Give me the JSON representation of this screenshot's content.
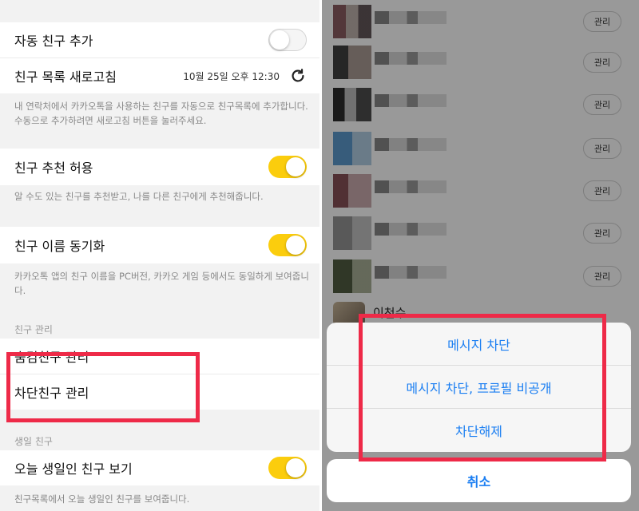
{
  "left": {
    "auto_add": {
      "label": "자동 친구 추가",
      "toggle": "off"
    },
    "refresh": {
      "label": "친구 목록 새로고침",
      "timestamp": "10월 25일 오후 12:30",
      "icon": "refresh-icon"
    },
    "auto_add_desc": "내 연락처에서 카카오톡을 사용하는 친구를 자동으로 친구목록에 추가합니다. 수동으로 추가하려면 새로고침 버튼을 눌러주세요.",
    "recommend": {
      "label": "친구 추천 허용",
      "toggle": "on"
    },
    "recommend_desc": "알 수도 있는 친구를 추천받고, 나를 다른 친구에게 추천해줍니다.",
    "name_sync": {
      "label": "친구 이름 동기화",
      "toggle": "on"
    },
    "name_sync_desc": "카카오톡 앱의 친구 이름을 PC버전, 카카오 게임 등에서도 동일하게 보여줍니다.",
    "section_manage": "친구 관리",
    "hidden_manage": "숨김친구 관리",
    "blocked_manage": "차단친구 관리",
    "section_birthday": "생일 친구",
    "birthday": {
      "label": "오늘 생일인 친구 보기",
      "toggle": "on"
    },
    "birthday_desc": "친구목록에서 오늘 생일인 친구를 보여줍니다."
  },
  "right": {
    "manage_label": "관리",
    "friend_rows": 7,
    "peek_name": "이천수",
    "sheet": {
      "items": [
        "메시지 차단",
        "메시지 차단, 프로필 비공개",
        "차단해제"
      ],
      "cancel": "취소"
    }
  },
  "colors": {
    "toggle_on": "#fbcd0d",
    "action_blue": "#1a7ef2",
    "highlight_red": "#ee2a48"
  }
}
